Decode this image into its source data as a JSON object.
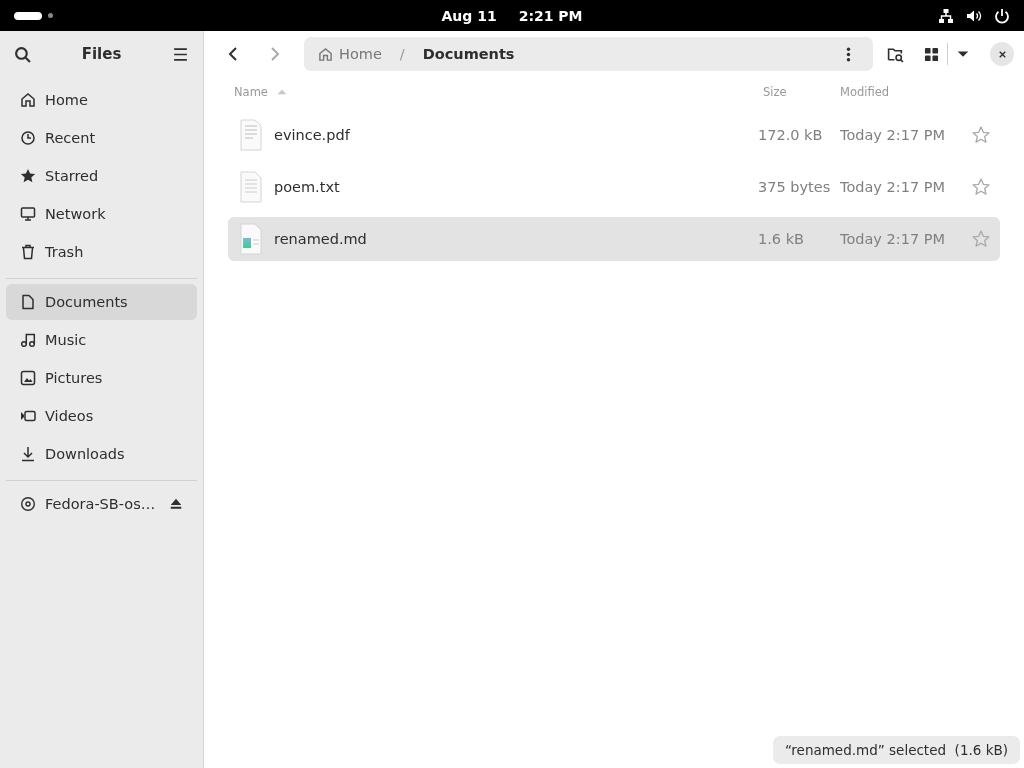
{
  "top_bar": {
    "date": "Aug 11",
    "time": "2:21 PM"
  },
  "sidebar": {
    "title": "Files",
    "items": [
      {
        "label": "Home",
        "kind": "home",
        "selected": false
      },
      {
        "label": "Recent",
        "kind": "recent",
        "selected": false
      },
      {
        "label": "Starred",
        "kind": "starred",
        "selected": false
      },
      {
        "label": "Network",
        "kind": "network",
        "selected": false
      },
      {
        "label": "Trash",
        "kind": "trash",
        "selected": false
      },
      {
        "label": "Documents",
        "kind": "documents",
        "selected": true
      },
      {
        "label": "Music",
        "kind": "music",
        "selected": false
      },
      {
        "label": "Pictures",
        "kind": "pictures",
        "selected": false
      },
      {
        "label": "Videos",
        "kind": "videos",
        "selected": false
      },
      {
        "label": "Downloads",
        "kind": "downloads",
        "selected": false
      },
      {
        "label": "Fedora-SB-os…",
        "kind": "drive",
        "selected": false
      }
    ]
  },
  "path": [
    "Home",
    "Documents"
  ],
  "path_separator": "/",
  "columns": [
    {
      "label": "Name",
      "sorted": true
    },
    {
      "label": "Size",
      "sorted": false
    },
    {
      "label": "Modified",
      "sorted": false
    }
  ],
  "files": [
    {
      "name": "evince.pdf",
      "kind": "pdf",
      "size": "172.0 kB",
      "modified": "Today 2:17 PM",
      "starred": false,
      "selected": false
    },
    {
      "name": "poem.txt",
      "kind": "text",
      "size": "375 bytes",
      "modified": "Today 2:17 PM",
      "starred": false,
      "selected": false
    },
    {
      "name": "renamed.md",
      "kind": "markdown",
      "size": "1.6 kB",
      "modified": "Today 2:17 PM",
      "starred": false,
      "selected": true
    }
  ],
  "status": "“renamed.md” selected  (1.6 kB)"
}
